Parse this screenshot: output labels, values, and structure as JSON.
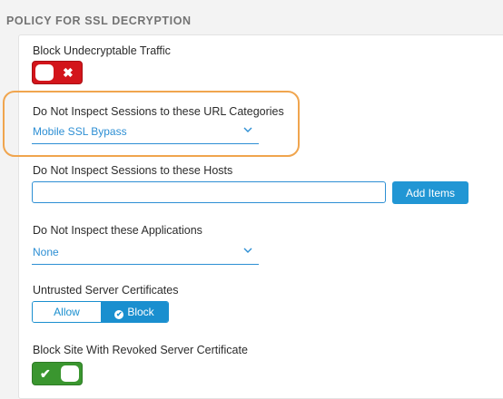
{
  "section": {
    "title": "POLICY FOR SSL DECRYPTION"
  },
  "block_undecryptable": {
    "label": "Block Undecryptable Traffic",
    "state": "off",
    "glyph": "✖",
    "color": "#d3151b"
  },
  "url_categories": {
    "label": "Do Not Inspect Sessions to these URL Categories",
    "value": "Mobile SSL Bypass",
    "highlight_color": "#f0a54e"
  },
  "hosts": {
    "label": "Do Not Inspect Sessions to these Hosts",
    "value": "",
    "add_button": "Add Items"
  },
  "applications": {
    "label": "Do Not Inspect these Applications",
    "value": "None"
  },
  "untrusted_certs": {
    "label": "Untrusted Server Certificates",
    "options": [
      "Allow",
      "Block"
    ],
    "selected": "Block",
    "accent": "#1a8fcf"
  },
  "revoked_cert": {
    "label": "Block Site With Revoked Server Certificate",
    "state": "on",
    "glyph": "✔",
    "color": "#3a962f"
  }
}
